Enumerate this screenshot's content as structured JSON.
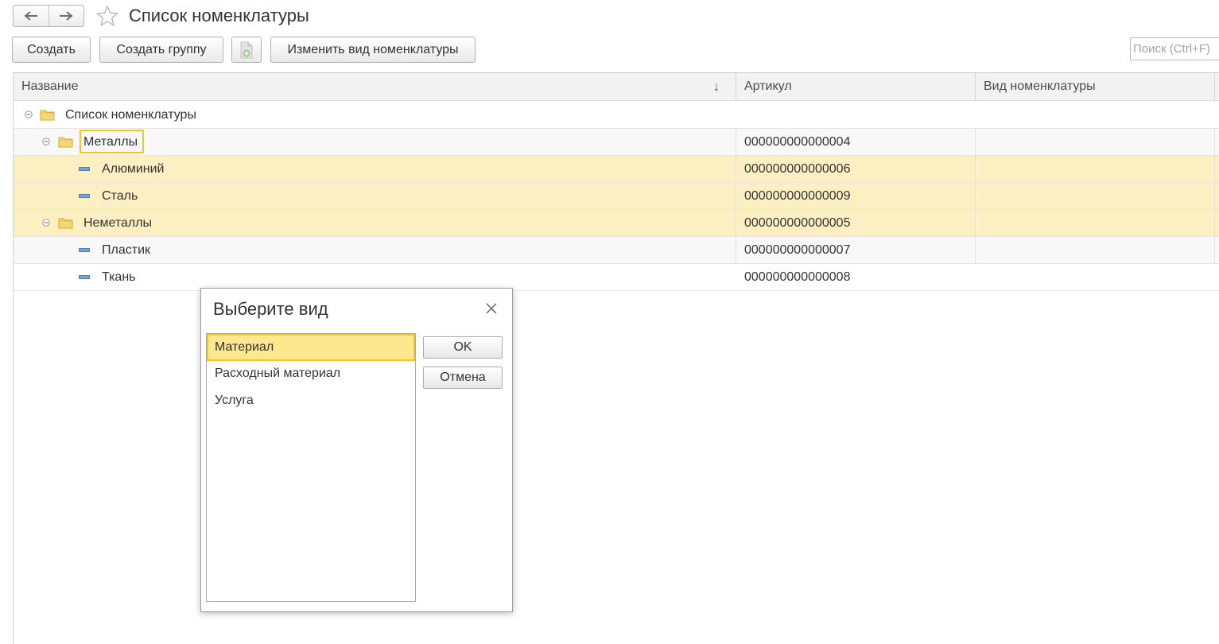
{
  "window": {
    "title": "Список номенклатуры"
  },
  "toolbar": {
    "create_label": "Создать",
    "create_group_label": "Создать группу",
    "change_kind_label": "Изменить вид номенклатуры",
    "search_placeholder": "Поиск (Ctrl+F)"
  },
  "grid": {
    "columns": [
      "Название",
      "Артикул",
      "Вид номенклатуры"
    ],
    "sort_indicator": "↓",
    "rows": [
      {
        "name": "Список номенклатуры",
        "article": "",
        "kind": ""
      },
      {
        "name": "Металлы",
        "article": "000000000000004",
        "kind": ""
      },
      {
        "name": "Алюминий",
        "article": "000000000000006",
        "kind": ""
      },
      {
        "name": "Сталь",
        "article": "000000000000009",
        "kind": ""
      },
      {
        "name": "Неметаллы",
        "article": "000000000000005",
        "kind": ""
      },
      {
        "name": "Пластик",
        "article": "000000000000007",
        "kind": ""
      },
      {
        "name": "Ткань",
        "article": "000000000000008",
        "kind": ""
      }
    ]
  },
  "dialog": {
    "title": "Выберите вид",
    "items": [
      "Материал",
      "Расходный материал",
      "Услуга"
    ],
    "selected": "Материал",
    "ok_label": "OK",
    "cancel_label": "Отмена"
  },
  "colors": {
    "selection_fill": "#fcefc2",
    "focus_border": "#f2c530",
    "folder": "#f5d774",
    "item_icon": "#7ba3cc"
  }
}
